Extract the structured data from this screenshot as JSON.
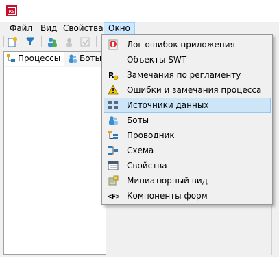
{
  "app": {
    "icon": "app-logo-icon"
  },
  "menubar": {
    "items": [
      {
        "label": "Файл"
      },
      {
        "label": "Вид"
      },
      {
        "label": "Свойства"
      },
      {
        "label": "Окно"
      }
    ],
    "active_index": 3
  },
  "toolbar": {
    "buttons": [
      "new-icon",
      "filter-icon",
      "users-icon",
      "disabled-tool-icon",
      "disabled-tool-icon"
    ]
  },
  "panel": {
    "tabs": [
      {
        "label": "Процессы",
        "icon": "processes-icon"
      },
      {
        "label": "Боты",
        "icon": "bots-icon"
      }
    ]
  },
  "window_menu": {
    "items": [
      {
        "label": "Лог ошибок приложения",
        "icon": "error-log-icon"
      },
      {
        "label": "Объекты SWT",
        "icon": ""
      },
      {
        "label": "Замечания по регламенту",
        "icon": "reglament-icon"
      },
      {
        "label": "Ошибки и замечания процесса",
        "icon": "warning-icon"
      },
      {
        "label": "Источники данных",
        "icon": "data-sources-icon"
      },
      {
        "label": "Боты",
        "icon": "bots-icon"
      },
      {
        "label": "Проводник",
        "icon": "explorer-icon"
      },
      {
        "label": "Схема",
        "icon": "schema-icon"
      },
      {
        "label": "Свойства",
        "icon": "properties-icon"
      },
      {
        "label": "Миниатюрный вид",
        "icon": "thumbnail-icon"
      },
      {
        "label": "Компоненты форм",
        "icon": "form-components-icon"
      }
    ],
    "highlighted_index": 4
  },
  "colors": {
    "accent_highlight": "#cde6f7",
    "menu_active": "#cce8ff",
    "error_red": "#e03030",
    "warning_yellow": "#f5c400"
  }
}
